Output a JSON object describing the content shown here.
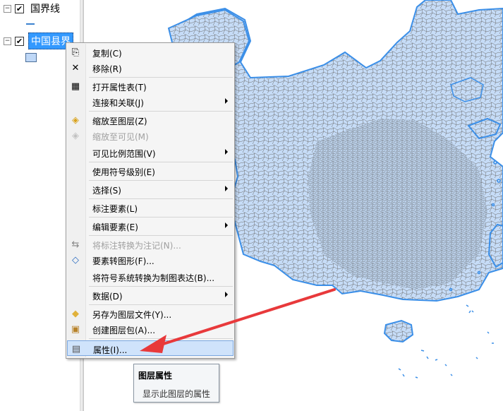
{
  "toc": {
    "layers": [
      {
        "name": "国界线",
        "checked": true,
        "expanded": true,
        "symbol": "line-symbol"
      },
      {
        "name": "中国县界",
        "display_name": "中国县界",
        "checked": true,
        "expanded": true,
        "selected": true,
        "symbol": "polygon-symbol"
      }
    ],
    "check_glyph": "✔",
    "collapse_glyph": "−"
  },
  "context_menu": {
    "items": [
      {
        "label": "复制(C)",
        "icon": "copy-icon",
        "glyph": "⎘"
      },
      {
        "label": "移除(R)",
        "icon": "remove-icon",
        "glyph": "✕"
      },
      {
        "label": "打开属性表(T)",
        "icon": "table-icon",
        "glyph": "▦"
      },
      {
        "label": "连接和关联(J)",
        "submenu": true
      },
      {
        "label": "缩放至图层(Z)",
        "icon": "zoom-to-layer-icon",
        "glyph": "◈"
      },
      {
        "label": "缩放至可见(M)",
        "icon": "zoom-to-visible-icon",
        "glyph": "◈",
        "disabled": true
      },
      {
        "label": "可见比例范围(V)",
        "submenu": true
      },
      {
        "label": "使用符号级别(E)"
      },
      {
        "label": "选择(S)",
        "submenu": true
      },
      {
        "label": "标注要素(L)"
      },
      {
        "label": "编辑要素(E)",
        "submenu": true
      },
      {
        "label": "将标注转换为注记(N)...",
        "icon": "convert-labels-icon",
        "glyph": "⇆",
        "disabled": true
      },
      {
        "label": "要素转图形(F)...",
        "icon": "features-to-graphics-icon",
        "glyph": "◇"
      },
      {
        "label": "将符号系统转换为制图表达(B)..."
      },
      {
        "label": "数据(D)",
        "submenu": true
      },
      {
        "label": "另存为图层文件(Y)...",
        "icon": "save-layer-file-icon",
        "glyph": "◆"
      },
      {
        "label": "创建图层包(A)...",
        "icon": "layer-package-icon",
        "glyph": "▣"
      },
      {
        "label": "属性(I)...",
        "icon": "properties-icon",
        "glyph": "▤",
        "highlighted": true
      }
    ]
  },
  "tooltip": {
    "title": "图层属性",
    "description": "显示此图层的属性"
  },
  "colors": {
    "map_fill": "#c6dcf7",
    "map_border": "#3b8fe8",
    "county_lines": "#6a6a6a",
    "annotation_arrow": "#e8393b",
    "selection": "#3399ff"
  }
}
